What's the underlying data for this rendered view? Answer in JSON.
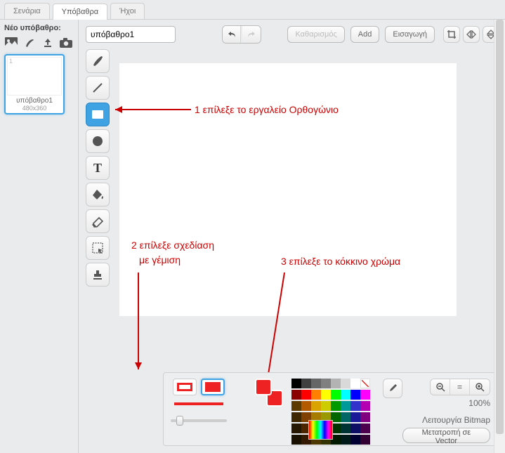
{
  "tabs": {
    "scripts": "Σενάρια",
    "backdrops": "Υπόβαθρα",
    "sounds": "Ήχοι"
  },
  "left": {
    "new_backdrop": "Νέο υπόβαθρο:",
    "thumb": {
      "index": "1",
      "name": "υπόβαθρο1",
      "dim": "480x360"
    }
  },
  "topbar": {
    "name_value": "υπόβαθρο1",
    "clear": "Καθαρισμός",
    "add": "Add",
    "import": "Εισαγωγή"
  },
  "annotations": {
    "a1": "1 επίλεξε το εργαλείο Ορθογώνιο",
    "a2a": "2 επίλεξε σχεδίαση",
    "a2b": "με γέμιση",
    "a3": "3 επίλεξε το κόκκινο χρώμα"
  },
  "bottom": {
    "zoom_pct": "100%",
    "mode": "Λειτουργία Bitmap",
    "convert": "Μετατροπή σε Vector"
  },
  "palette": {
    "rows": [
      [
        "#000000",
        "#404040",
        "#666666",
        "#808080",
        "#b3b3b3",
        "#d9d9d9",
        "#ffffff",
        "NOFILL"
      ],
      [
        "#8b0000",
        "#ff0000",
        "#ff8000",
        "#ffff00",
        "#00ff00",
        "#00ffff",
        "#0000ff",
        "#ff00ff"
      ],
      [
        "#5c3a00",
        "#b35900",
        "#d9a300",
        "#cccc00",
        "#009900",
        "#009999",
        "#3333cc",
        "#b300b3"
      ],
      [
        "#3d2600",
        "#804000",
        "#a67c00",
        "#999900",
        "#006600",
        "#006666",
        "#1a1a99",
        "#800080"
      ],
      [
        "#261800",
        "#4d2600",
        "#735600",
        "#666600",
        "#003300",
        "#003333",
        "#0d0d66",
        "#4d004d"
      ],
      [
        "#1a1000",
        "#331a00",
        "#4d3900",
        "#333300",
        "#001a00",
        "#001a1a",
        "#000033",
        "#330033"
      ]
    ]
  }
}
